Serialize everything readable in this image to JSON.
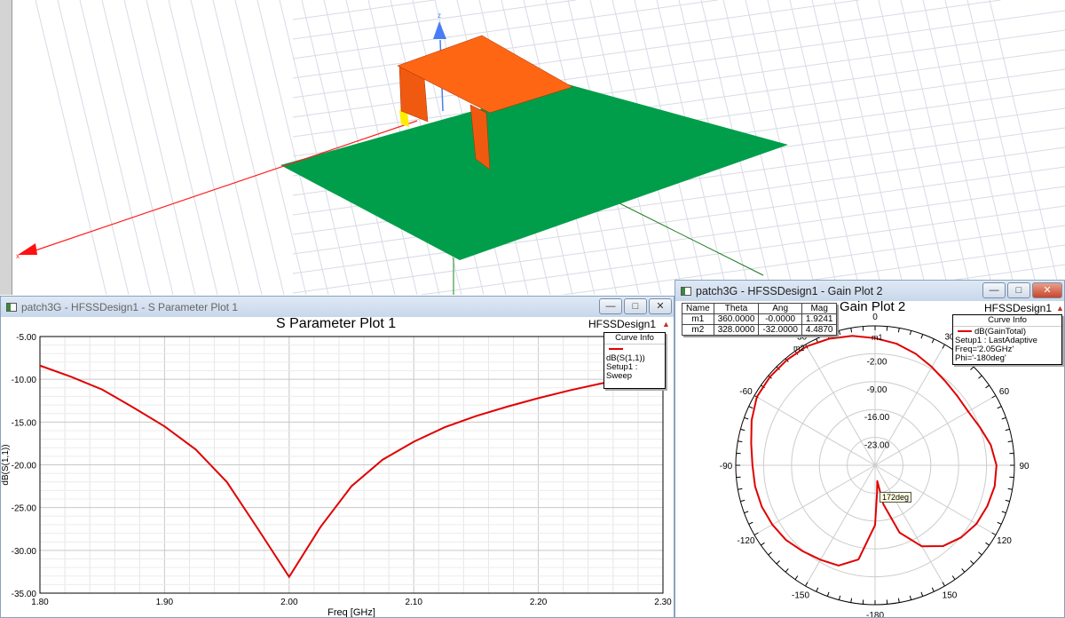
{
  "modeler": {
    "axis_z_label": "z",
    "axis_x_label": "x",
    "colors": {
      "ground": "#009e4a",
      "patch": "#ff6614",
      "port": "#ffff00",
      "x_axis": "#ff0000",
      "z_axis": "#4a7cf5"
    }
  },
  "s_window": {
    "title": "patch3G - HFSSDesign1 - S Parameter Plot 1",
    "plot_title": "S Parameter Plot 1",
    "design": "HFSSDesign1",
    "legend": {
      "header": "Curve Info",
      "curve": "dB(S(1,1))",
      "setup": "Setup1 : Sweep"
    }
  },
  "g_window": {
    "title": "patch3G - HFSSDesign1 - Gain Plot 2",
    "plot_title": "Gain Plot 2",
    "design": "HFSSDesign1",
    "legend": {
      "header": "Curve Info",
      "curve": "dB(GainTotal)",
      "setup": "Setup1 : LastAdaptive",
      "freq": "Freq='2.05GHz' Phi='-180deg'"
    },
    "markers": {
      "headers": [
        "Name",
        "Theta",
        "Ang",
        "Mag"
      ],
      "rows": [
        [
          "m1",
          "360.0000",
          "-0.0000",
          "1.9241"
        ],
        [
          "m2",
          "328.0000",
          "-32.0000",
          "4.4870"
        ]
      ]
    },
    "tooltip": "172deg"
  },
  "chart_data": [
    {
      "type": "line",
      "title": "S Parameter Plot 1",
      "xlabel": "Freq [GHz]",
      "ylabel": "dB(S(1,1))",
      "xlim": [
        1.8,
        2.3
      ],
      "ylim": [
        -35,
        -5
      ],
      "xticks": [
        "1.80",
        "1.90",
        "2.00",
        "2.10",
        "2.20",
        "2.30"
      ],
      "yticks": [
        "-5.00",
        "-10.00",
        "-15.00",
        "-20.00",
        "-25.00",
        "-30.00",
        "-35.00"
      ],
      "grid": true,
      "legend": "top-right",
      "series": [
        {
          "name": "dB(S(1,1))",
          "color": "#e00000",
          "x": [
            1.8,
            1.825,
            1.85,
            1.875,
            1.9,
            1.925,
            1.95,
            1.975,
            2.0,
            2.025,
            2.05,
            2.075,
            2.1,
            2.125,
            2.15,
            2.175,
            2.2,
            2.225,
            2.25,
            2.275,
            2.3
          ],
          "y": [
            -8.4,
            -9.7,
            -11.2,
            -13.3,
            -15.5,
            -18.2,
            -22.0,
            -27.5,
            -33.1,
            -27.3,
            -22.5,
            -19.4,
            -17.3,
            -15.6,
            -14.3,
            -13.2,
            -12.2,
            -11.3,
            -10.5,
            -9.8,
            -9.2
          ]
        }
      ]
    },
    {
      "type": "polar",
      "title": "Gain Plot 2",
      "rlim": [
        -30,
        5
      ],
      "rticks": [
        "-2.00",
        "-9.00",
        "-16.00",
        "-23.00"
      ],
      "angle_ticks": [
        "0",
        "30",
        "60",
        "90",
        "120",
        "150",
        "-180",
        "-150",
        "-120",
        "-90",
        "-60",
        "-30"
      ],
      "legend": "top-right",
      "series": [
        {
          "name": "dB(GainTotal)",
          "color": "#e00000",
          "theta": [
            -180,
            -170,
            -160,
            -150,
            -140,
            -130,
            -120,
            -110,
            -100,
            -90,
            -80,
            -70,
            -60,
            -50,
            -40,
            -30,
            -20,
            -10,
            0,
            10,
            20,
            30,
            40,
            50,
            60,
            70,
            80,
            90,
            100,
            110,
            120,
            130,
            140,
            150,
            160,
            168,
            172,
            176,
            180
          ],
          "gain": [
            -15,
            -6,
            -3.2,
            -2.6,
            -1.8,
            -0.8,
            -0.2,
            0.3,
            0.6,
            0.8,
            1.6,
            3,
            4.3,
            4.5,
            4.5,
            4.45,
            3.8,
            3,
            1.92,
            1.0,
            -0.2,
            -1.5,
            -2.5,
            -3,
            -3,
            -2,
            -0.5,
            0.5,
            0.5,
            0,
            -0.6,
            -1.8,
            -3.5,
            -6.5,
            -12,
            -20,
            -26,
            -23,
            -15
          ]
        }
      ]
    }
  ]
}
